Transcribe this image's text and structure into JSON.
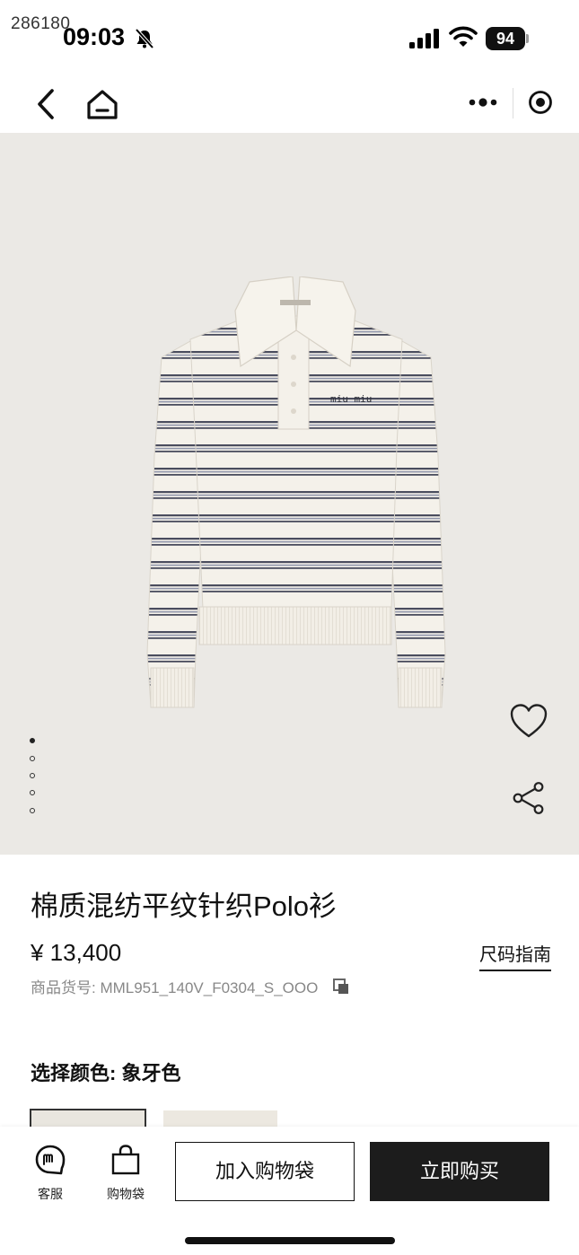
{
  "status_bar": {
    "watermark": "286180",
    "time": "09:03",
    "battery": "94"
  },
  "nav": {
    "back_icon": "chevron-left",
    "home_icon": "home",
    "more_icon": "ellipsis",
    "close_icon": "target-circle"
  },
  "gallery": {
    "image_count": 5,
    "active_index": 0,
    "logo_text": "miu miu"
  },
  "product": {
    "title": "棉质混纺平纹针织Polo衫",
    "price": "¥ 13,400",
    "size_guide": "尺码指南",
    "sku": "商品货号: MML951_140V_F0304_S_OOO",
    "color_label": "选择颜色: 象牙色"
  },
  "bottom_bar": {
    "service_label": "客服",
    "bag_label": "购物袋",
    "add_to_bag": "加入购物袋",
    "buy_now": "立即购买"
  },
  "colors": {
    "image_bg": "#ebe9e5",
    "sweater_base": "#f4f1ea",
    "stripe_dark": "#4a4d5e",
    "stripe_light": "#8f95aa",
    "buy_button": "#1c1c1c"
  }
}
